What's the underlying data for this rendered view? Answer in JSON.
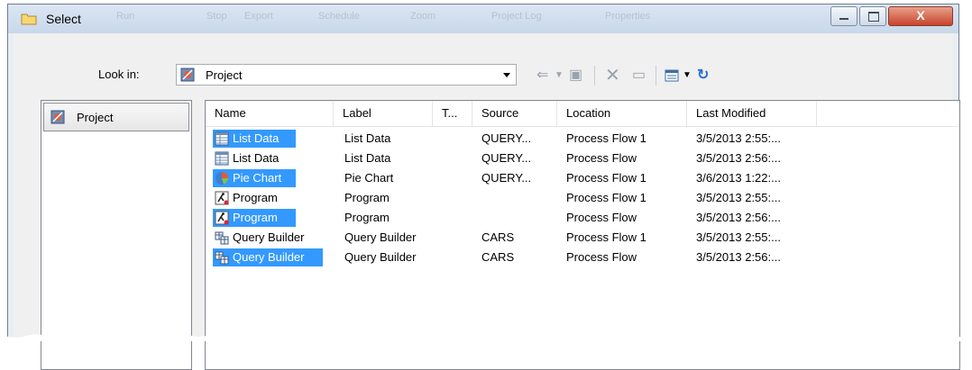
{
  "window": {
    "title": "Select",
    "ghost_menu": [
      "Run",
      "Stop",
      "Export",
      "Schedule",
      "Zoom",
      "Project Log",
      "Properties"
    ],
    "controls": {
      "minimize": "—",
      "maximize": "□",
      "close": "X"
    }
  },
  "lookin": {
    "label": "Look in:",
    "value": "Project",
    "icon": "project-icon"
  },
  "toolbar": {
    "icons": [
      "back-arrow-icon",
      "dropdown-icon",
      "up-folder-icon",
      "delete-icon",
      "new-folder-icon",
      "view-menu-icon",
      "refresh-icon"
    ]
  },
  "places": {
    "items": [
      {
        "label": "Project",
        "icon": "project-icon"
      }
    ]
  },
  "list": {
    "columns": [
      "Name",
      "Label",
      "T...",
      "Source",
      "Location",
      "Last Modified"
    ],
    "rows": [
      {
        "name": "List Data",
        "label": "List Data",
        "type": "",
        "source": "QUERY...",
        "location": "Process Flow 1",
        "modified": "3/5/2013 2:55:...",
        "icon": "list-data-icon",
        "selected": true
      },
      {
        "name": "List Data",
        "label": "List Data",
        "type": "",
        "source": "QUERY...",
        "location": "Process Flow",
        "modified": "3/5/2013 2:56:...",
        "icon": "list-data-icon",
        "selected": false
      },
      {
        "name": "Pie Chart",
        "label": "Pie Chart",
        "type": "",
        "source": "QUERY...",
        "location": "Process Flow 1",
        "modified": "3/6/2013 1:22:...",
        "icon": "pie-chart-icon",
        "selected": true
      },
      {
        "name": "Program",
        "label": "Program",
        "type": "",
        "source": "",
        "location": "Process Flow 1",
        "modified": "3/5/2013 2:55:...",
        "icon": "program-icon",
        "selected": false
      },
      {
        "name": "Program",
        "label": "Program",
        "type": "",
        "source": "",
        "location": "Process Flow",
        "modified": "3/5/2013 2:56:...",
        "icon": "program-icon",
        "selected": true
      },
      {
        "name": "Query Builder",
        "label": "Query Builder",
        "type": "",
        "source": "CARS",
        "location": "Process Flow 1",
        "modified": "3/5/2013 2:55:...",
        "icon": "query-builder-icon",
        "selected": false
      },
      {
        "name": "Query Builder",
        "label": "Query Builder",
        "type": "",
        "source": "CARS",
        "location": "Process Flow",
        "modified": "3/5/2013 2:56:...",
        "icon": "query-builder-icon",
        "selected": true
      }
    ]
  },
  "colors": {
    "selection": "#3399ff",
    "title_gradient_top": "#dbe6f3",
    "close_button": "#c8442b"
  }
}
